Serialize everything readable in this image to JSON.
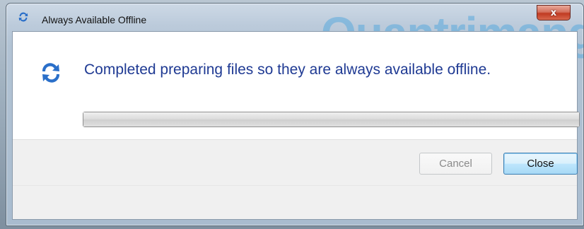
{
  "window": {
    "title": "Always Available Offline",
    "title_icon": "sync-arrows-icon",
    "close_glyph": "x"
  },
  "watermark": "Quantrimang",
  "content": {
    "icon": "sync-arrows-icon",
    "message": "Completed preparing files so they are always available offline.",
    "progress": 1.0
  },
  "buttons": {
    "cancel_label": "Cancel",
    "close_label": "Close"
  },
  "colors": {
    "message_text": "#1f3a93",
    "icon_blue": "#2a6fc9",
    "close_red": "#c03a22"
  }
}
